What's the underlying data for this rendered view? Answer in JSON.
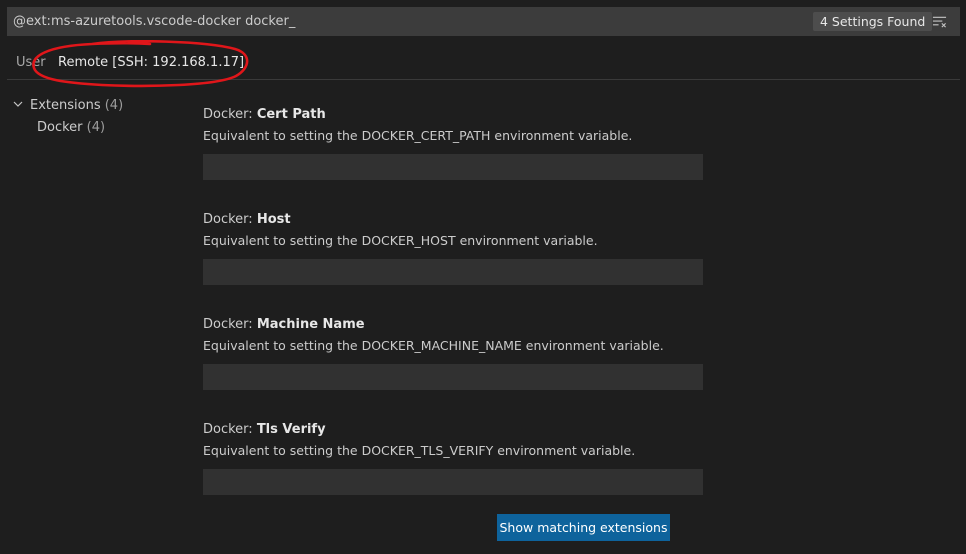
{
  "search": {
    "value": "@ext:ms-azuretools.vscode-docker docker_",
    "results_badge": "4 Settings Found",
    "clear_icon": "clear-filter-icon"
  },
  "tabs": [
    {
      "label": "User",
      "active": false
    },
    {
      "label": "Remote [SSH: 192.168.1.17]",
      "active": true
    }
  ],
  "annotation": {
    "color": "#e0161a",
    "shape": "hand-drawn-ellipse"
  },
  "toc": {
    "extensions": {
      "label": "Extensions",
      "count": "(4)",
      "icon": "chevron-down-icon"
    },
    "docker": {
      "label": "Docker",
      "count": "(4)"
    }
  },
  "settings": [
    {
      "category": "Docker: ",
      "name": "Cert Path",
      "description": "Equivalent to setting the DOCKER_CERT_PATH environment variable.",
      "value": ""
    },
    {
      "category": "Docker: ",
      "name": "Host",
      "description": "Equivalent to setting the DOCKER_HOST environment variable.",
      "value": ""
    },
    {
      "category": "Docker: ",
      "name": "Machine Name",
      "description": "Equivalent to setting the DOCKER_MACHINE_NAME environment variable.",
      "value": ""
    },
    {
      "category": "Docker: ",
      "name": "Tls Verify",
      "description": "Equivalent to setting the DOCKER_TLS_VERIFY environment variable.",
      "value": ""
    }
  ],
  "footer": {
    "button_label": "Show matching extensions"
  },
  "colors": {
    "background": "#1e1e1e",
    "input_background": "#3c3c3c",
    "setting_input_background": "#313131",
    "button_background": "#0e639c",
    "annotation": "#e0161a"
  }
}
